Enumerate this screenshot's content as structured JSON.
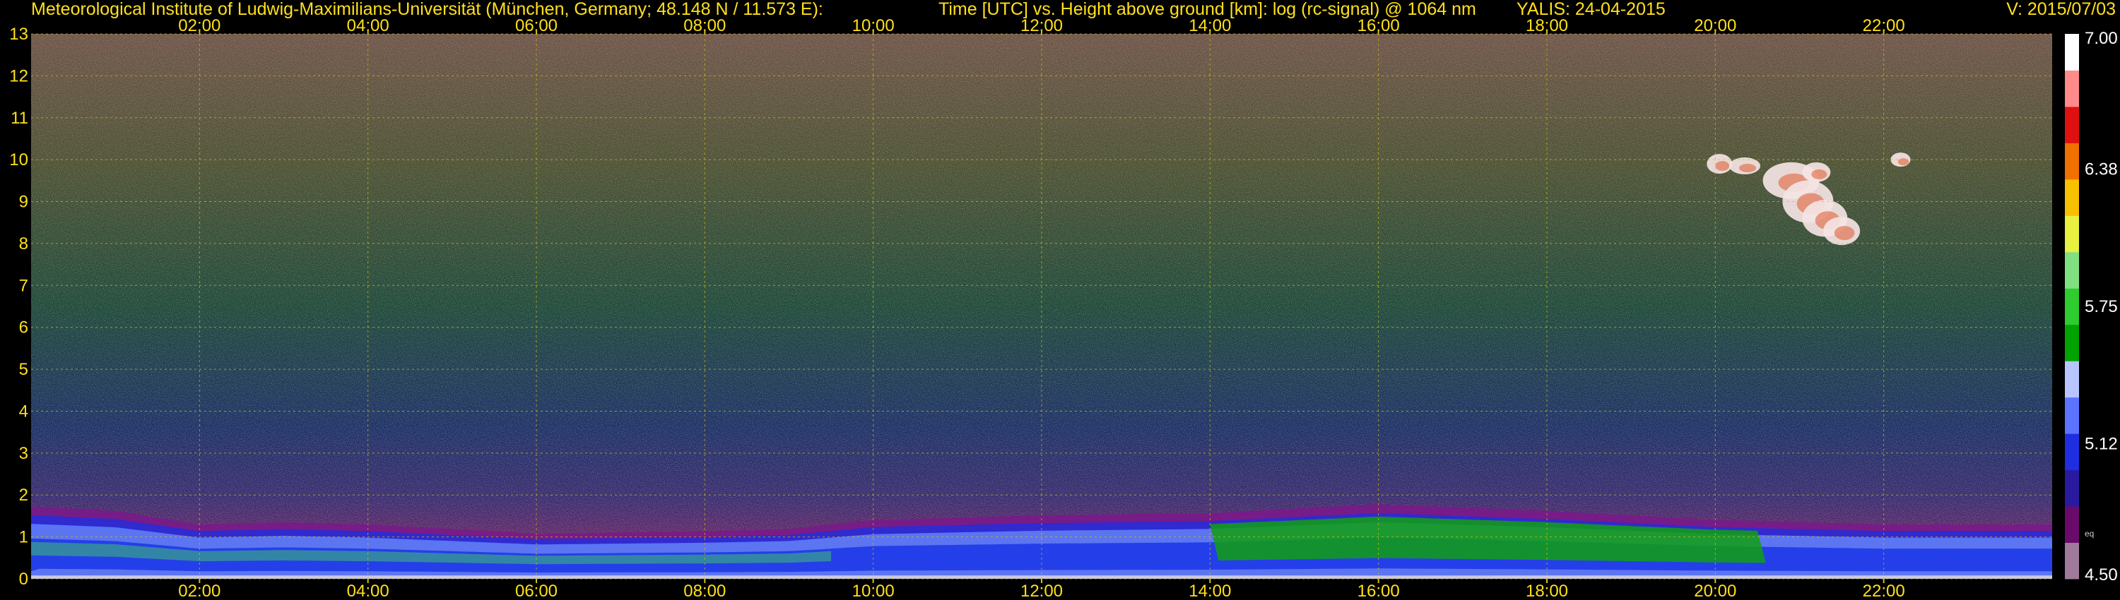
{
  "header": {
    "institute": "Meteorological Institute of Ludwig-Maximilians-Universität (München, Germany; 48.148 N / 11.573 E):",
    "description": "Time [UTC] vs. Height above ground [km]: log (rc-signal) @ 1064 nm",
    "instrument": "YALIS: 24-04-2015",
    "version": "V: 2015/07/03"
  },
  "colors": {
    "background": "#000000",
    "text": "#ffe01a",
    "grid": "#d6c200",
    "colorbar": [
      "#a07a9a",
      "#6a0a6a",
      "#2a1aa0",
      "#1e2ee0",
      "#5a74ff",
      "#b8c4ff",
      "#00a300",
      "#2ecc2e",
      "#80e080",
      "#e8f040",
      "#f7c000",
      "#f07000",
      "#e01010",
      "#ff8a8a",
      "#ffffff"
    ]
  },
  "chart_data": {
    "type": "heatmap",
    "title": "Time [UTC] vs. Height above ground [km]: log (rc-signal) @ 1064 nm",
    "xlabel": "Time [UTC]",
    "ylabel": "Height above ground [km]",
    "x_unit": "hours UTC",
    "y_unit": "km",
    "xlim": [
      0,
      24
    ],
    "ylim": [
      0,
      13
    ],
    "x_tick_labels": [
      "02:00",
      "04:00",
      "06:00",
      "08:00",
      "10:00",
      "12:00",
      "14:00",
      "16:00",
      "18:00",
      "20:00",
      "22:00"
    ],
    "x_tick_values": [
      2,
      4,
      6,
      8,
      10,
      12,
      14,
      16,
      18,
      20,
      22
    ],
    "y_tick_labels": [
      "0",
      "1",
      "2",
      "3",
      "4",
      "5",
      "6",
      "7",
      "8",
      "9",
      "10",
      "11",
      "12",
      "13"
    ],
    "y_tick_values": [
      0,
      1,
      2,
      3,
      4,
      5,
      6,
      7,
      8,
      9,
      10,
      11,
      12,
      13
    ],
    "grid": true,
    "colorbar": {
      "range": [
        4.5,
        7.0
      ],
      "tick_values": [
        4.5,
        5.12,
        5.75,
        6.38,
        7.0
      ],
      "tick_labels": [
        "4.50",
        "5.12",
        "5.75",
        "6.38",
        "7.00"
      ],
      "small_label": "eq"
    },
    "boundary_layer_top": [
      {
        "time": 0.0,
        "height": 1.6
      },
      {
        "time": 1.0,
        "height": 1.5
      },
      {
        "time": 2.0,
        "height": 1.2
      },
      {
        "time": 3.0,
        "height": 1.25
      },
      {
        "time": 4.0,
        "height": 1.2
      },
      {
        "time": 5.0,
        "height": 1.1
      },
      {
        "time": 6.0,
        "height": 1.0
      },
      {
        "time": 8.0,
        "height": 1.05
      },
      {
        "time": 9.0,
        "height": 1.1
      },
      {
        "time": 10.0,
        "height": 1.3
      },
      {
        "time": 12.0,
        "height": 1.4
      },
      {
        "time": 14.0,
        "height": 1.45
      },
      {
        "time": 16.0,
        "height": 1.65
      },
      {
        "time": 18.0,
        "height": 1.5
      },
      {
        "time": 20.0,
        "height": 1.3
      },
      {
        "time": 22.0,
        "height": 1.2
      },
      {
        "time": 24.0,
        "height": 1.2
      }
    ],
    "cirrus_cloud": {
      "time_range": [
        19.9,
        22.3
      ],
      "height_range": [
        7.8,
        10.2
      ]
    }
  }
}
